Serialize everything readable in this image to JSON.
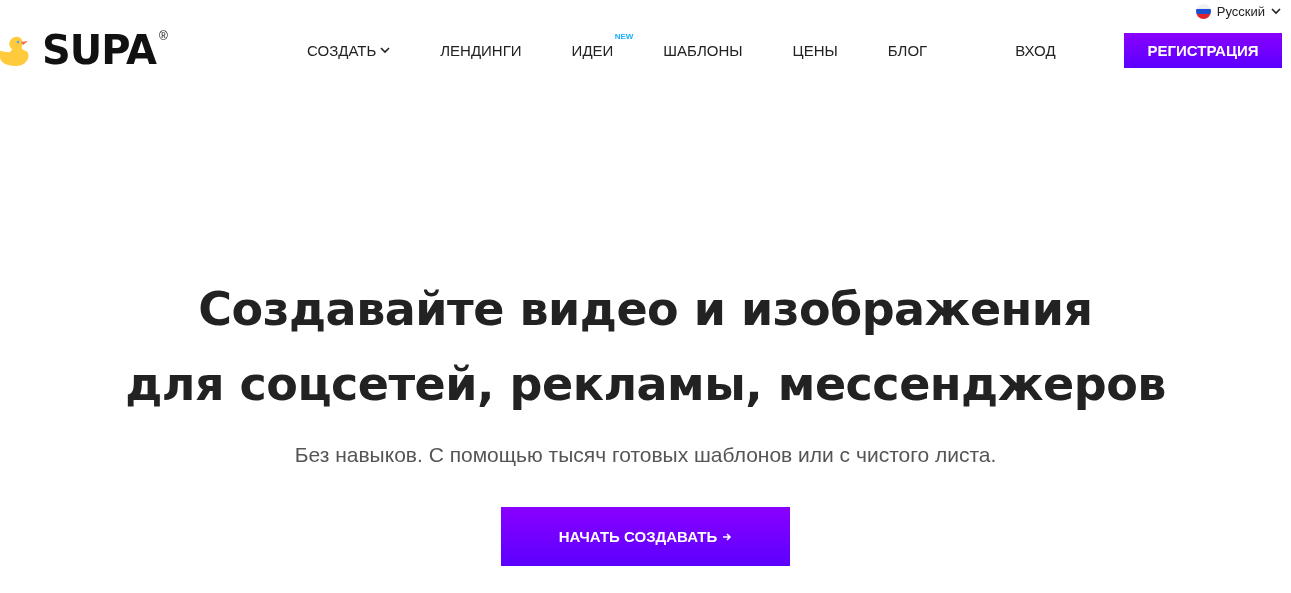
{
  "language": {
    "label": "Русский"
  },
  "logo": {
    "name": "SUPA",
    "mark": "®"
  },
  "nav": [
    {
      "label": "СОЗДАТЬ",
      "kind": "dropdown"
    },
    {
      "label": "ЛЕНДИНГИ",
      "kind": "link"
    },
    {
      "label": "ИДЕИ",
      "kind": "link",
      "badge": "NEW"
    },
    {
      "label": "ШАБЛОНЫ",
      "kind": "link"
    },
    {
      "label": "ЦЕНЫ",
      "kind": "link"
    },
    {
      "label": "БЛОГ",
      "kind": "link"
    }
  ],
  "login": "ВХОД",
  "register": "РЕГИСТРАЦИЯ",
  "hero": {
    "title_lines": [
      "Создавайте видео и изображения",
      "для соцсетей, рекламы, мессенджеров"
    ],
    "subtitle": "Без навыков. С помощью тысяч готовых шаблонов или с чистого листа.",
    "cta": "НАЧАТЬ СОЗДАВАТЬ"
  }
}
